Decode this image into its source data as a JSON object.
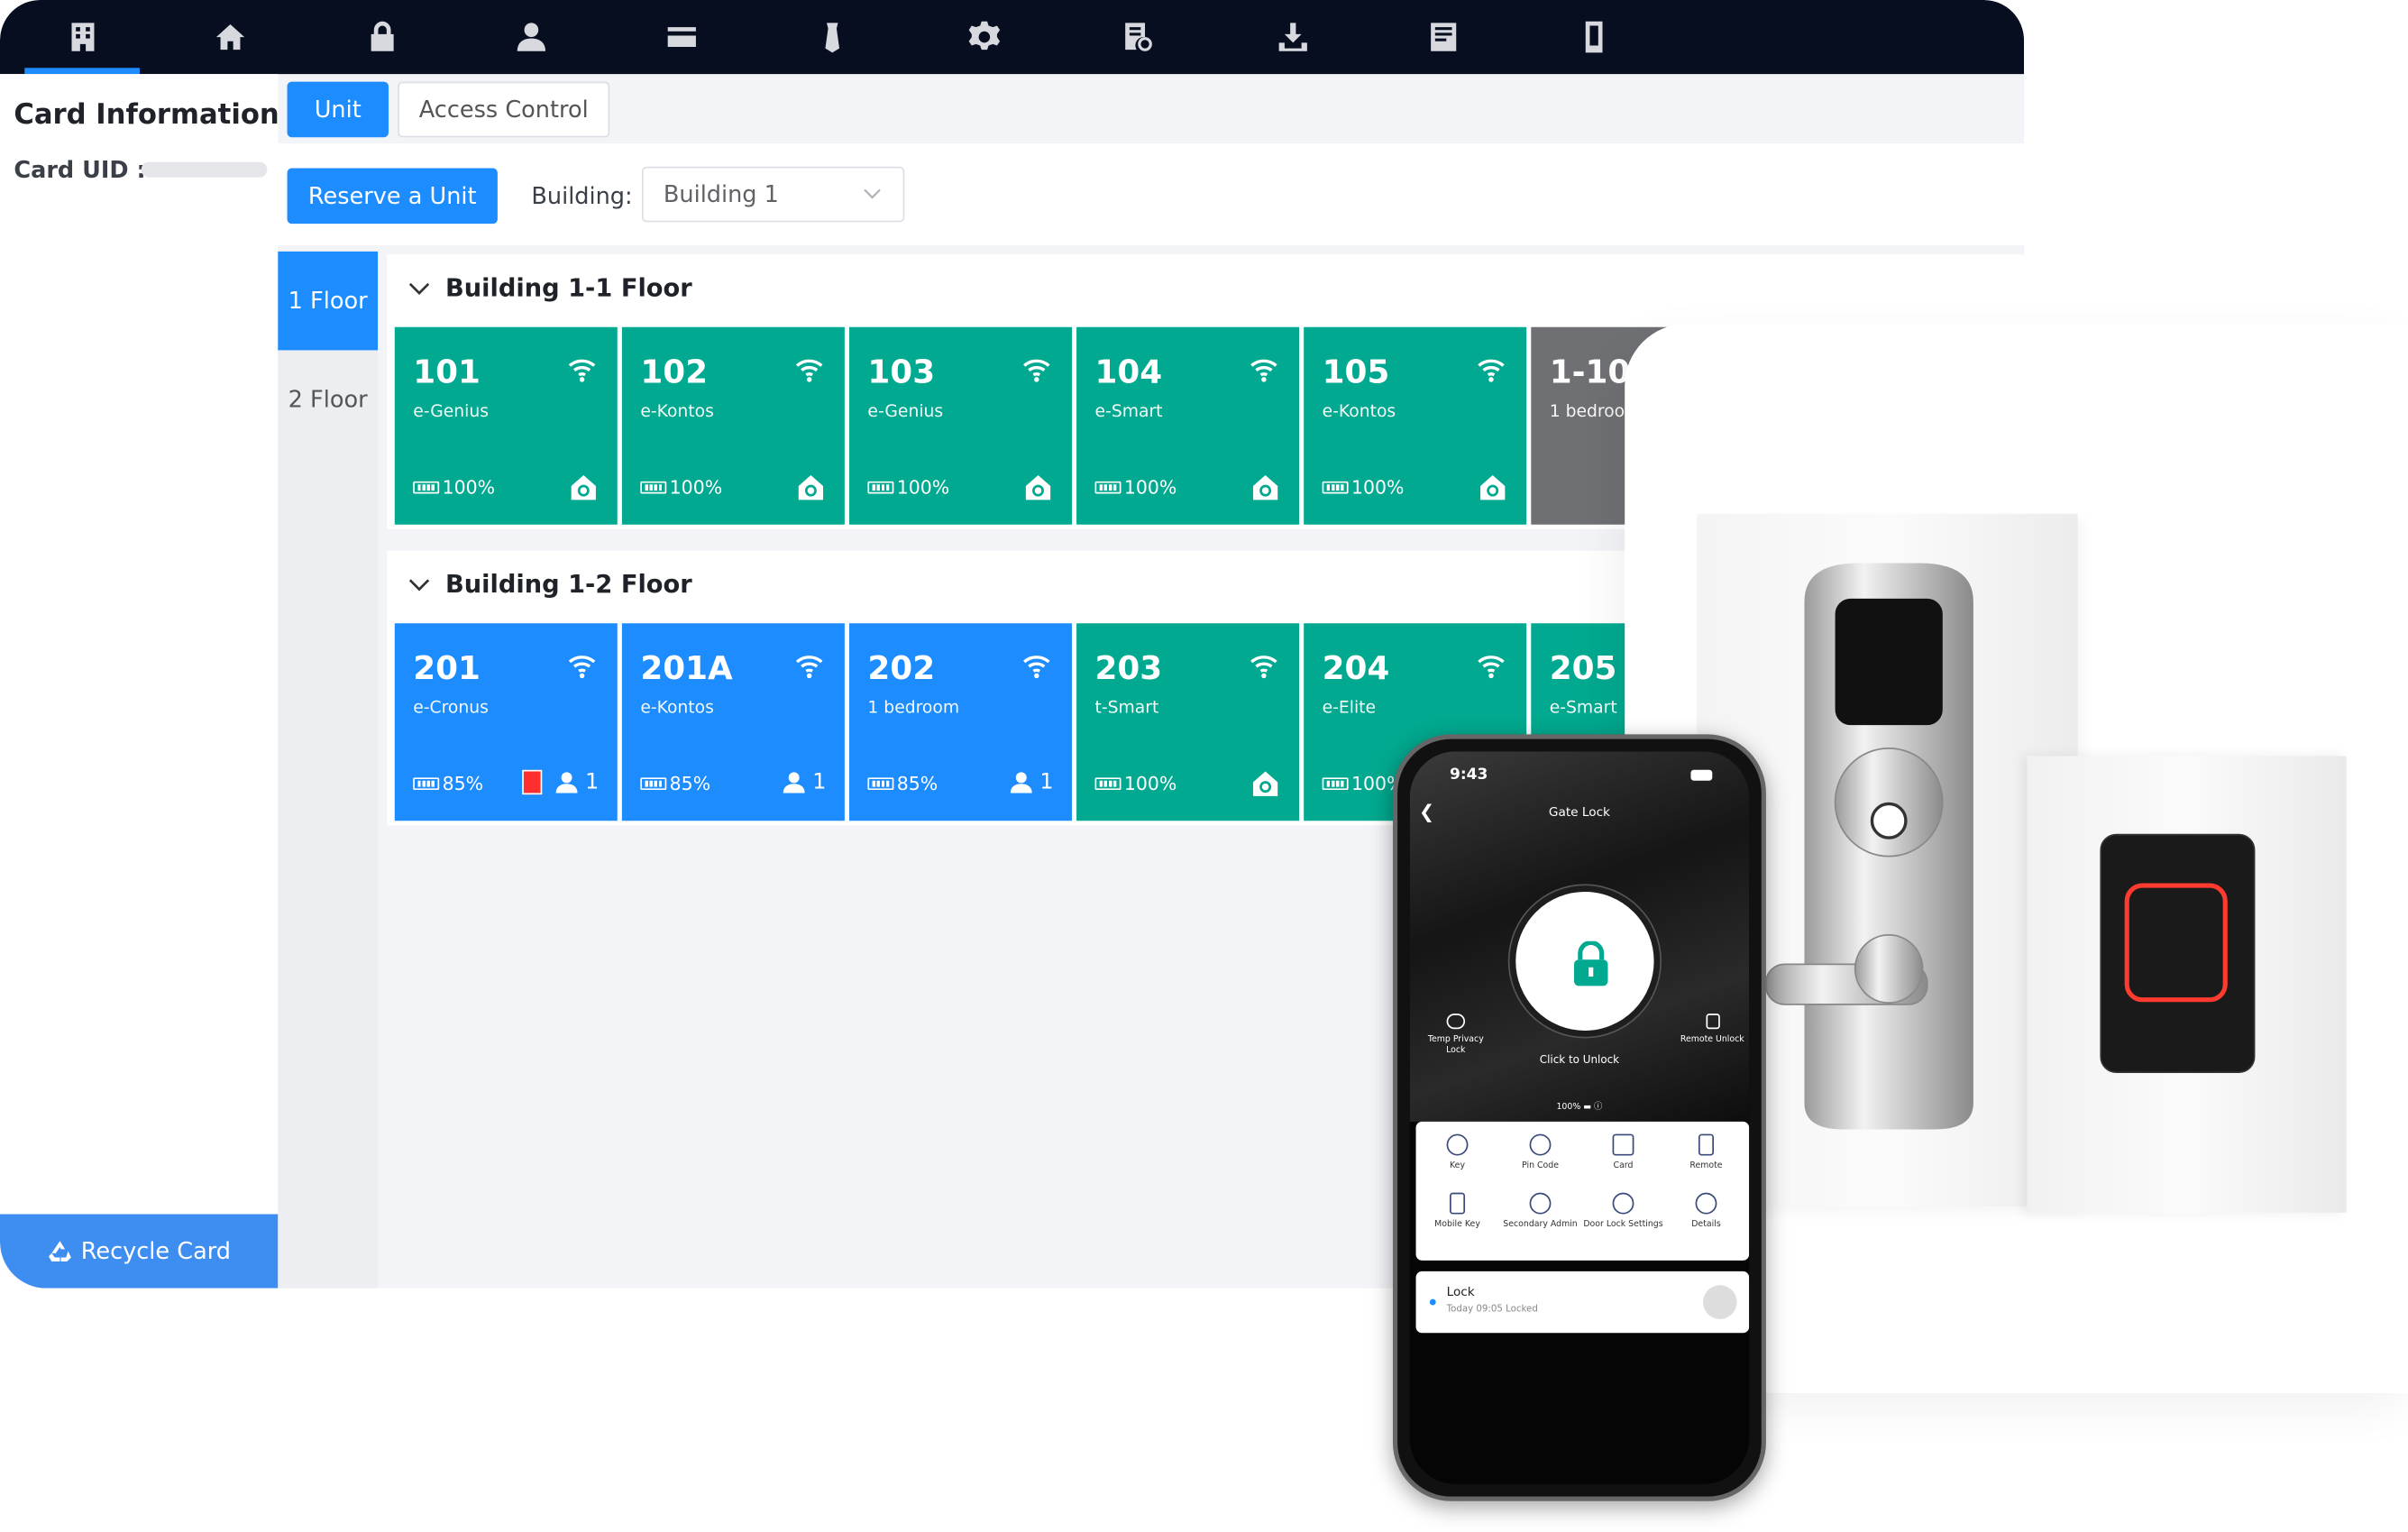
{
  "card_info": {
    "title": "Card Information",
    "uid_label": "Card UID :"
  },
  "tabs": [
    {
      "label": "Unit"
    },
    {
      "label": "Access Control"
    }
  ],
  "toolbar": {
    "reserve_label": "Reserve a Unit",
    "building_label": "Building:",
    "building_value": "Building 1"
  },
  "recycle_label": "Recycle Card",
  "floors_nav": [
    {
      "label": "1 Floor"
    },
    {
      "label": "2 Floor"
    }
  ],
  "floor_sections": [
    {
      "title": "Building 1-1 Floor",
      "rooms": [
        {
          "number": "101",
          "type": "e-Genius",
          "battery": "100%"
        },
        {
          "number": "102",
          "type": "e-Kontos",
          "battery": "100%"
        },
        {
          "number": "103",
          "type": "e-Genius",
          "battery": "100%"
        },
        {
          "number": "104",
          "type": "e-Smart",
          "battery": "100%"
        },
        {
          "number": "105",
          "type": "e-Kontos",
          "battery": "100%"
        },
        {
          "number": "1-10",
          "type": "1 bedroo"
        }
      ]
    },
    {
      "title": "Building 1-2 Floor",
      "rooms": [
        {
          "number": "201",
          "type": "e-Cronus",
          "battery": "85%",
          "occupants": "1"
        },
        {
          "number": "201A",
          "type": "e-Kontos",
          "battery": "85%",
          "occupants": "1"
        },
        {
          "number": "202",
          "type": "1 bedroom",
          "battery": "85%",
          "occupants": "1"
        },
        {
          "number": "203",
          "type": "t-Smart",
          "battery": "100%"
        },
        {
          "number": "204",
          "type": "e-Elite",
          "battery": "100%"
        },
        {
          "number": "205",
          "type": "e-Smart"
        }
      ]
    }
  ],
  "phone": {
    "time": "9:43",
    "title": "Gate Lock",
    "click_unlock": "Click to Unlock",
    "temp_privacy": "Temp Privacy Lock",
    "remote_unlock": "Remote Unlock",
    "battery_pct": "100%",
    "grid": [
      {
        "label": "Key",
        "icon": "key-icon"
      },
      {
        "label": "Pin Code",
        "icon": "pin-code-icon"
      },
      {
        "label": "Card",
        "icon": "card-icon"
      },
      {
        "label": "Remote",
        "icon": "remote-icon"
      },
      {
        "label": "Mobile Key",
        "icon": "mobile-key-icon"
      },
      {
        "label": "Secondary Admin",
        "icon": "secondary-admin-icon"
      },
      {
        "label": "Door Lock Settings",
        "icon": "door-lock-settings-icon"
      },
      {
        "label": "Details",
        "icon": "details-icon"
      }
    ],
    "lock_name": "Lock",
    "lock_status": "Today 09:05  Locked"
  },
  "colors": {
    "accent": "#1c8cff",
    "teal": "#00a98f",
    "topbar": "#070e20",
    "occupied_door": "#ff2f2f"
  }
}
